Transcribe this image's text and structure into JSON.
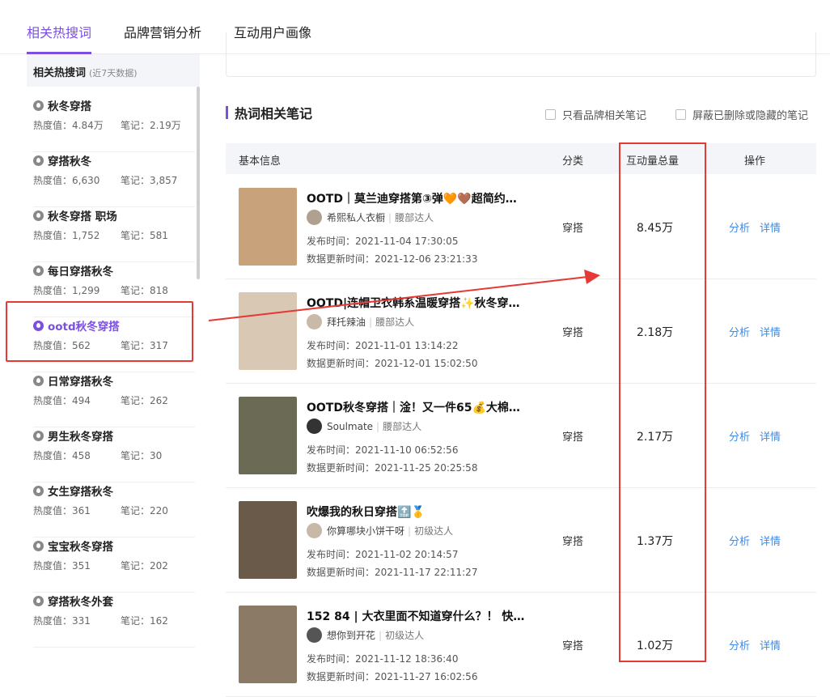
{
  "tabs": [
    {
      "label": "相关热搜词",
      "active": true
    },
    {
      "label": "品牌营销分析",
      "active": false
    },
    {
      "label": "互动用户画像",
      "active": false
    }
  ],
  "sidebar": {
    "header": "相关热搜词",
    "header_note": "(近7天数据)",
    "items": [
      {
        "keyword": "秋冬穿搭",
        "heat": "热度值：4.84万",
        "notes": "笔记：2.19万",
        "active": false
      },
      {
        "keyword": "穿搭秋冬",
        "heat": "热度值：6,630",
        "notes": "笔记：3,857",
        "active": false
      },
      {
        "keyword": "秋冬穿搭 职场",
        "heat": "热度值：1,752",
        "notes": "笔记：581",
        "active": false
      },
      {
        "keyword": "每日穿搭秋冬",
        "heat": "热度值：1,299",
        "notes": "笔记：818",
        "active": false
      },
      {
        "keyword": "ootd秋冬穿搭",
        "heat": "热度值：562",
        "notes": "笔记：317",
        "active": true
      },
      {
        "keyword": "日常穿搭秋冬",
        "heat": "热度值：494",
        "notes": "笔记：262",
        "active": false
      },
      {
        "keyword": "男生秋冬穿搭",
        "heat": "热度值：458",
        "notes": "笔记：30",
        "active": false
      },
      {
        "keyword": "女生穿搭秋冬",
        "heat": "热度值：361",
        "notes": "笔记：220",
        "active": false
      },
      {
        "keyword": "宝宝秋冬穿搭",
        "heat": "热度值：351",
        "notes": "笔记：202",
        "active": false
      },
      {
        "keyword": "穿搭秋冬外套",
        "heat": "热度值：331",
        "notes": "笔记：162",
        "active": false
      }
    ]
  },
  "main": {
    "section_title": "热词相关笔记",
    "filter_brand": "只看品牌相关笔记",
    "filter_deleted": "屏蔽已删除或隐藏的笔记",
    "columns": [
      "基本信息",
      "分类",
      "互动量总量",
      "操作"
    ],
    "action_analyze": "分析",
    "action_detail": "详情",
    "rows": [
      {
        "title": "OOTD｜莫兰迪穿搭第③弹🧡🤎超简约…",
        "author": "希熙私人衣橱",
        "level": "腰部达人",
        "pub": "发布时间：2021-11-04 17:30:05",
        "upd": "数据更新时间：2021-12-06 23:21:33",
        "category": "穿搭",
        "interaction": "8.45万",
        "thumb_color": "#c8a27a",
        "avatar_color": "#b0a090"
      },
      {
        "title": "OOTD|连帽卫衣韩系温暖穿搭✨秋冬穿…",
        "author": "拜托辣油",
        "level": "腰部达人",
        "pub": "发布时间：2021-11-01 13:14:22",
        "upd": "数据更新时间：2021-12-01 15:02:50",
        "category": "穿搭",
        "interaction": "2.18万",
        "thumb_color": "#d9c8b4",
        "avatar_color": "#c9b9a8"
      },
      {
        "title": "OOTD秋冬穿搭｜淦！又一件65💰大棉服…",
        "author": "Soulmate",
        "level": "腰部达人",
        "pub": "发布时间：2021-11-10 06:52:56",
        "upd": "数据更新时间：2021-11-25 20:25:58",
        "category": "穿搭",
        "interaction": "2.17万",
        "thumb_color": "#6b6a55",
        "avatar_color": "#333333"
      },
      {
        "title": "吹爆我的秋日穿搭🔝🥇",
        "author": "你算哪块小饼干呀",
        "level": "初级达人",
        "pub": "发布时间：2021-11-02 20:14:57",
        "upd": "数据更新时间：2021-11-17 22:11:27",
        "category": "穿搭",
        "interaction": "1.37万",
        "thumb_color": "#6a5a4a",
        "avatar_color": "#c8b8a8"
      },
      {
        "title": "152 84 | 大衣里面不知道穿什么？！ 快来…",
        "author": "想你到开花",
        "level": "初级达人",
        "pub": "发布时间：2021-11-12 18:36:40",
        "upd": "数据更新时间：2021-11-27 16:02:56",
        "category": "穿搭",
        "interaction": "1.02万",
        "thumb_color": "#8a7a66",
        "avatar_color": "#555555"
      }
    ]
  }
}
